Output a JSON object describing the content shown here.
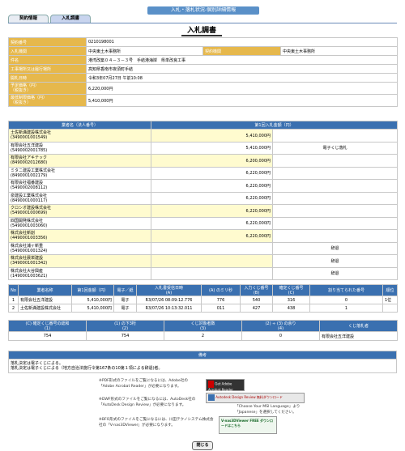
{
  "page_header": "入札・落札状況-個別詳細情報",
  "tabs": {
    "contract_info": "契約情報",
    "bid_report": "入札調書"
  },
  "title": "入札調書",
  "info": {
    "contract_no": {
      "label": "契約番号",
      "value": "0210198001"
    },
    "bid_org": {
      "label": "入札機関",
      "value": "中央東土木事務所"
    },
    "contract_org": {
      "label": "契約機関",
      "value": "中央東土木事務所"
    },
    "case_name": {
      "label": "件名",
      "value": "港湾改築０４－３－３号　手結港海岸　県単改良工事"
    },
    "place": {
      "label": "工事場所又は履行場所",
      "value": "高知県香南市夜須町手結"
    },
    "opening": {
      "label": "開札日時",
      "value": "令和3年07月27日 午前10:08"
    },
    "planned_price": {
      "label": "予定価格（円）\n（税抜き）",
      "value": "6,220,000円"
    },
    "min_price": {
      "label": "最低制限価格（円）\n（税抜き）",
      "value": "5,410,000円"
    }
  },
  "bidders_header": {
    "name": "業者名（法人番号）",
    "amount": "第1回入札金額（円）"
  },
  "bidders": [
    {
      "name": "土佐新満建設株式会社",
      "num": "(3490001001549)",
      "amount": "5,410,000円",
      "note": "",
      "hl": true
    },
    {
      "name": "有限会社五洋建設",
      "num": "(5490002001785)",
      "amount": "5,410,000円",
      "note": "電子くじ落札",
      "hl": false
    },
    {
      "name": "有限会社アキテック",
      "num": "(8490002012680)",
      "amount": "6,200,000円",
      "note": "",
      "hl": true
    },
    {
      "name": "ミタニ建設工業株式会社",
      "num": "(8490001002179)",
      "amount": "6,220,000円",
      "note": "",
      "hl": false
    },
    {
      "name": "有限会社福番建設",
      "num": "(5490002008112)",
      "amount": "6,220,000円",
      "note": "",
      "hl": false
    },
    {
      "name": "泉建設工業株式会社",
      "num": "(8490001000117)",
      "amount": "6,220,000円",
      "note": "",
      "hl": false
    },
    {
      "name": "クロシオ建設株式会社",
      "num": "(5490001000699)",
      "amount": "6,220,000円",
      "note": "",
      "hl": true
    },
    {
      "name": "四国開発株式会社",
      "num": "(5490001003060)",
      "amount": "6,220,000円",
      "note": "",
      "hl": false
    },
    {
      "name": "株式会社新創",
      "num": "(4490001003356)",
      "amount": "6,220,000円",
      "note": "",
      "hl": true
    },
    {
      "name": "株式会社浦ヶ新重",
      "num": "(5490001001324)",
      "amount": "",
      "note": "辞退",
      "hl": false
    },
    {
      "name": "株式会社晨栄建設",
      "num": "(3490001001342)",
      "amount": "",
      "note": "辞退",
      "hl": true
    },
    {
      "name": "株式会社大谷興産",
      "num": "(1490001003621)",
      "amount": "",
      "note": "辞退",
      "hl": false
    }
  ],
  "lottery_header": [
    "No",
    "業者名称",
    "第1回金額（円）",
    "電子／紙",
    "入札書受信日時\n(A)",
    "(A) のミリ秒",
    "入力くじ番号\n(B)",
    "確定くじ番号\n(C)",
    "割り当てられた番号",
    "順位"
  ],
  "lottery_rows": [
    [
      "1",
      "有限会社五洋建設",
      "5,410,000円",
      "電子",
      "R3/07/26 08:09:12.776",
      "776",
      "540",
      "316",
      "0",
      "1位"
    ],
    [
      "2",
      "土佐新満建設株式会社",
      "5,410,000円",
      "電子",
      "R3/07/26 10:13:32.011",
      "011",
      "427",
      "438",
      "1",
      ""
    ]
  ],
  "calc_header": [
    "(C) 確定くじ番号の総和\n(1)",
    "(1) の下3桁\n(2)",
    "くじ対象者数\n(3)",
    "(2) ÷ (3) の余り\n(4)",
    "くじ落札者"
  ],
  "calc_row": [
    "754",
    "754",
    "2",
    "0",
    "有限会社五洋建設"
  ],
  "remarks": {
    "label": "備考",
    "text": "落札決定は電子くじによる。\n落札決定は電子くじによる（地方自治法施行令第167条の10第１項による辞退)者。"
  },
  "notes": [
    "※PDF形式のファイルをご覧になるには、Adobe社の「Adobe Acrobat Reader」が必要になります。",
    "※DWF形式のファイルをご覧になるには、AutoDesk社の「AutoDesk Design Review」が必要になります。",
    "※BFO形式のファイルをご覧になるには、川田テクノシステム株式会社の「V-nas3DViewer」が必要になります。"
  ],
  "msi_text": "「Choose Your MSI Language」より「Japanese」を選択してください。",
  "ads": {
    "adobe": "Get Adobe Acrobat Reader",
    "autodesk": "Autodesk Design Review 無料ダウンロード",
    "vnas": "V-nas3DViewer FREE ダウンロードはこちら"
  },
  "close_button": "閉じる"
}
